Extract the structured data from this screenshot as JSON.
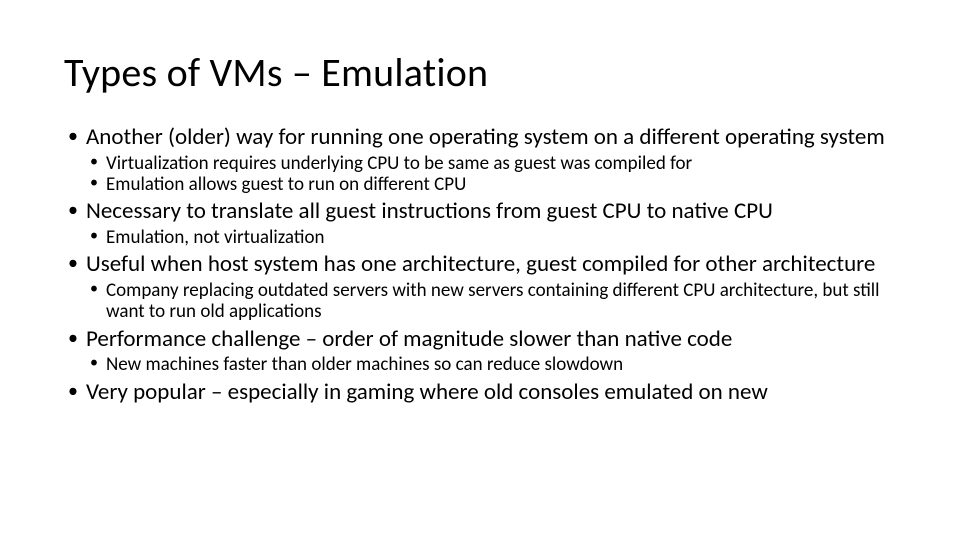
{
  "title": "Types of VMs – Emulation",
  "bullets": [
    {
      "text": "Another (older) way for running one operating system on a different operating system",
      "sub": [
        "Virtualization requires underlying CPU to be same as guest was compiled for",
        "Emulation allows guest to run on different CPU"
      ]
    },
    {
      "text": "Necessary to translate all guest instructions from guest CPU to native CPU",
      "sub": [
        "Emulation, not virtualization"
      ]
    },
    {
      "text": "Useful when host system has one architecture, guest compiled for other architecture",
      "sub": [
        "Company replacing outdated servers with new servers containing different CPU architecture, but still want to run old applications"
      ]
    },
    {
      "text": "Performance challenge – order of magnitude slower than native code",
      "sub": [
        "New machines faster than older machines so can reduce slowdown"
      ]
    },
    {
      "text": "Very popular – especially in gaming where old consoles emulated on new",
      "sub": []
    }
  ]
}
